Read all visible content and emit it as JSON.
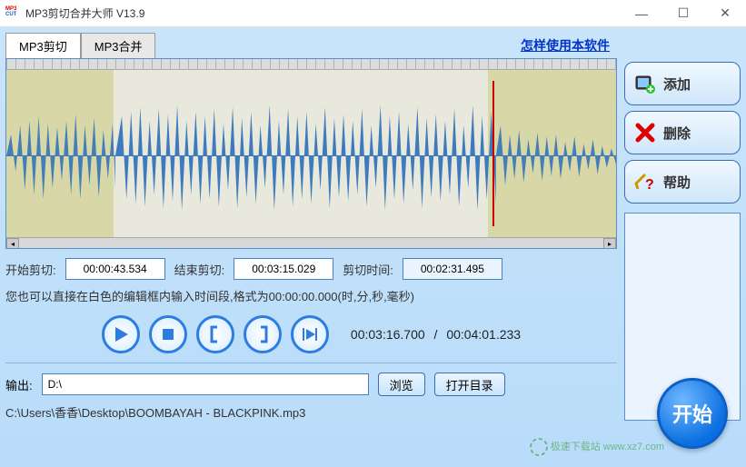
{
  "window": {
    "title": "MP3剪切合并大师 V13.9",
    "icon_top": "MP3",
    "icon_bottom": "CUT"
  },
  "tabs": {
    "cut": "MP3剪切",
    "merge": "MP3合并"
  },
  "help_link": "怎样使用本软件",
  "labels": {
    "start_cut": "开始剪切:",
    "end_cut": "结束剪切:",
    "cut_duration": "剪切时间:",
    "hint": "您也可以直接在白色的编辑框内输入时间段,格式为00:00:00.000(时,分,秒,毫秒)",
    "output": "输出:",
    "browse": "浏览",
    "open_dir": "打开目录",
    "start": "开始"
  },
  "times": {
    "start_cut": "00:00:43.534",
    "end_cut": "00:03:15.029",
    "duration": "00:02:31.495",
    "current": "00:03:16.700",
    "total": "00:04:01.233"
  },
  "output_path": "D:\\",
  "file_path": "C:\\Users\\香香\\Desktop\\BOOMBAYAH - BLACKPINK.mp3",
  "side": {
    "add": "添加",
    "delete": "删除",
    "help": "帮助"
  },
  "watermark": "极速下载站\nwww.xz7.com"
}
